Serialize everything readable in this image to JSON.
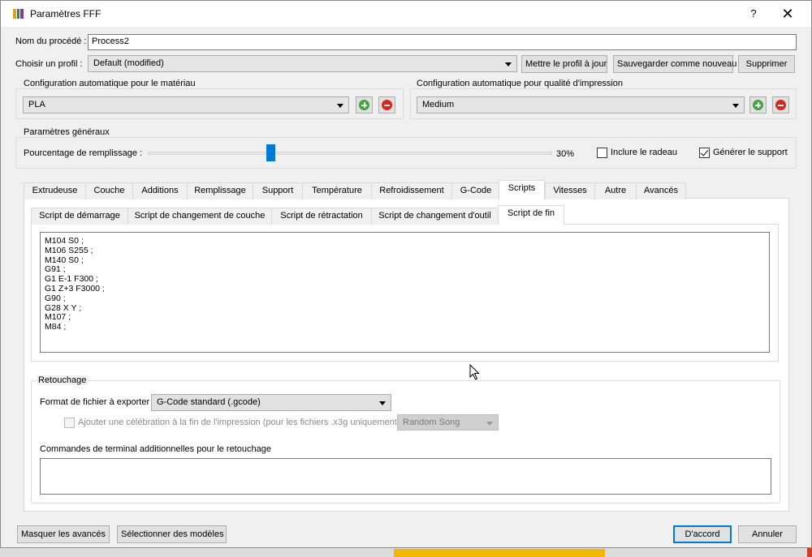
{
  "window": {
    "title": "Paramètres FFF",
    "help": "?",
    "close": "✕"
  },
  "process": {
    "name_label": "Nom du procédé :",
    "name_value": "Process2",
    "profile_label": "Choisir un profil :",
    "profile_value": "Default (modified)",
    "buttons": {
      "update": "Mettre le profil à jour",
      "save_new": "Sauvegarder comme nouveau",
      "delete": "Supprimer"
    }
  },
  "auto_material": {
    "title": "Configuration automatique pour le matériau",
    "value": "PLA"
  },
  "auto_quality": {
    "title": "Configuration automatique pour qualité d'impression",
    "value": "Medium"
  },
  "general": {
    "title": "Paramètres généraux",
    "infill_label": "Pourcentage de remplissage :",
    "infill_value_text": "30%",
    "infill_fraction": 0.3,
    "raft_label": "Inclure le radeau",
    "raft_checked": false,
    "support_label": "Générer le support",
    "support_checked": true
  },
  "tabs": [
    "Extrudeuse",
    "Couche",
    "Additions",
    "Remplissage",
    "Support",
    "Température",
    "Refroidissement",
    "G-Code",
    "Scripts",
    "Vitesses",
    "Autre",
    "Avancés"
  ],
  "active_tab": "Scripts",
  "subtabs": [
    "Script de démarrage",
    "Script de changement de couche",
    "Script de rétractation",
    "Script de changement d'outil",
    "Script de fin"
  ],
  "active_subtab": "Script de fin",
  "script_lines": [
    "M104 S0 ;",
    "M106 S255 ;",
    "M140 S0 ;",
    "G91 ;",
    "G1 E-1 F300 ;",
    "G1 Z+3 F3000 ;",
    "G90 ;",
    "G28 X Y ;",
    "M107 ;",
    "M84 ;"
  ],
  "postprocessing": {
    "title": "Retouchage",
    "export_label": "Format de fichier à exporter",
    "export_value": "G-Code standard (.gcode)",
    "celebration_label": "Ajouter une célébration à la fin de l'impression (pour les fichiers .x3g uniquement)",
    "celebration_checked": false,
    "song_value": "Random Song",
    "terminal_label": "Commandes de terminal additionnelles pour le retouchage",
    "terminal_value": ""
  },
  "footer": {
    "hide_advanced": "Masquer les avancés",
    "select_models": "Sélectionner des modèles",
    "ok": "D'accord",
    "cancel": "Annuler"
  },
  "colors": {
    "accent": "#0078d7",
    "add": "#3ea83a",
    "remove": "#d9261c"
  }
}
